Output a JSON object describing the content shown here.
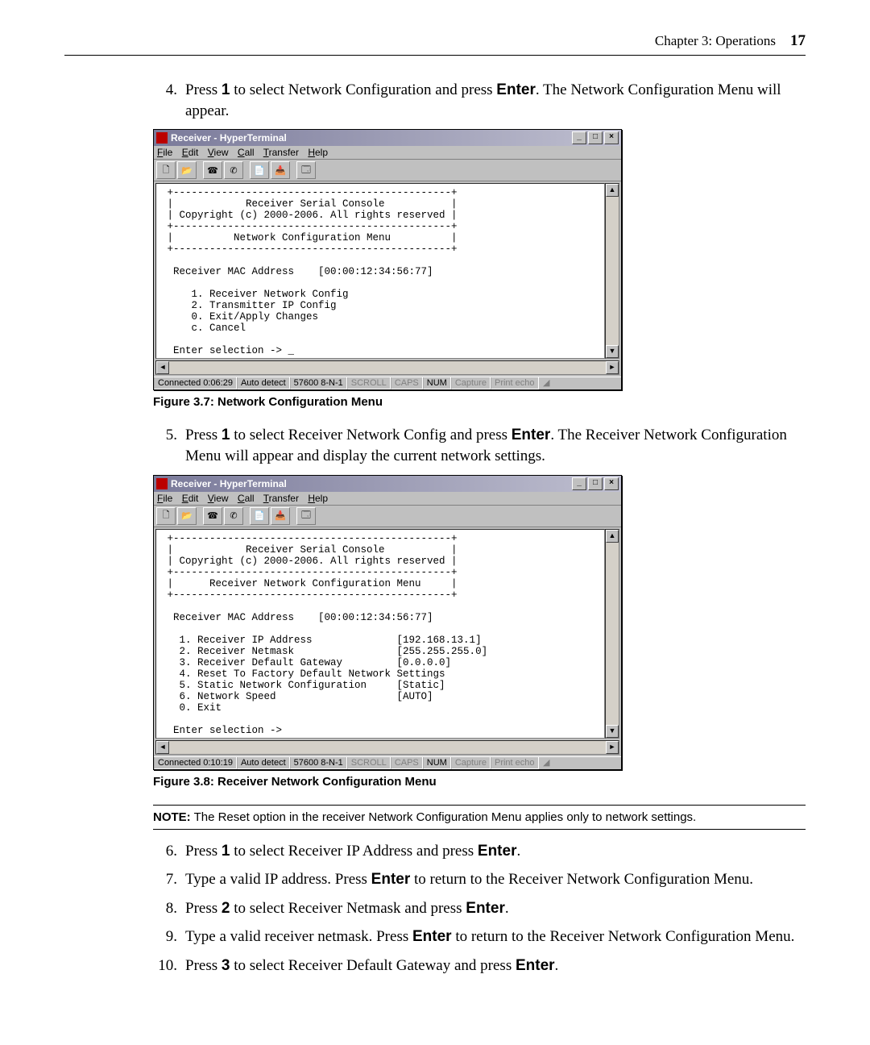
{
  "header": {
    "chapter": "Chapter 3: Operations",
    "page": "17"
  },
  "steps": {
    "s4": {
      "num": "4.",
      "pre": "Press ",
      "b1": "1",
      "mid1": " to select Network Configuration and press ",
      "b2": "Enter",
      "post": ". The Network Configuration Menu will appear."
    },
    "s5": {
      "num": "5.",
      "pre": "Press ",
      "b1": "1",
      "mid1": " to select Receiver Network Config and press ",
      "b2": "Enter",
      "post": ". The Receiver Network Configuration Menu will appear and display the current network settings."
    },
    "s6": {
      "num": "6.",
      "pre": "Press ",
      "b1": "1",
      "mid1": " to select Receiver IP Address and press ",
      "b2": "Enter",
      "post": "."
    },
    "s7": {
      "num": "7.",
      "pre": "Type a valid IP address. Press ",
      "b1": "Enter",
      "post": " to return to the Receiver Network Configuration Menu."
    },
    "s8": {
      "num": "8.",
      "pre": "Press ",
      "b1": "2",
      "mid1": " to select Receiver Netmask and press ",
      "b2": "Enter",
      "post": "."
    },
    "s9": {
      "num": "9.",
      "pre": "Type a valid receiver netmask. Press ",
      "b1": "Enter",
      "post": " to return to the Receiver Network Configuration Menu."
    },
    "s10": {
      "num": "10.",
      "pre": "Press ",
      "b1": "3",
      "mid1": " to select Receiver Default Gateway and press ",
      "b2": "Enter",
      "post": "."
    }
  },
  "captions": {
    "f37": "Figure 3.7: Network Configuration Menu",
    "f38": "Figure 3.8: Receiver Network Configuration Menu"
  },
  "note": {
    "label": "NOTE:",
    "text": " The Reset option in the receiver Network Configuration Menu applies only to network settings."
  },
  "hyperterm": {
    "title": "Receiver - HyperTerminal",
    "menus": {
      "file": "File",
      "edit": "Edit",
      "view": "View",
      "call": "Call",
      "transfer": "Transfer",
      "help": "Help"
    },
    "term1": " +----------------------------------------------+\n |            Receiver Serial Console           |\n | Copyright (c) 2000-2006. All rights reserved |\n +----------------------------------------------+\n |          Network Configuration Menu          |\n +----------------------------------------------+\n\n  Receiver MAC Address    [00:00:12:34:56:77]\n\n     1. Receiver Network Config\n     2. Transmitter IP Config\n     0. Exit/Apply Changes\n     c. Cancel\n\n  Enter selection -> _\n",
    "term2": " +----------------------------------------------+\n |            Receiver Serial Console           |\n | Copyright (c) 2000-2006. All rights reserved |\n +----------------------------------------------+\n |      Receiver Network Configuration Menu     |\n +----------------------------------------------+\n\n  Receiver MAC Address    [00:00:12:34:56:77]\n\n   1. Receiver IP Address              [192.168.13.1]\n   2. Receiver Netmask                 [255.255.255.0]\n   3. Receiver Default Gateway         [0.0.0.0]\n   4. Reset To Factory Default Network Settings\n   5. Static Network Configuration     [Static]\n   6. Network Speed                    [AUTO]\n   0. Exit\n\n  Enter selection ->\n",
    "status1": {
      "conn": "Connected 0:06:29",
      "detect": "Auto detect",
      "baud": "57600 8-N-1",
      "scroll": "SCROLL",
      "caps": "CAPS",
      "num": "NUM",
      "capture": "Capture",
      "echo": "Print echo"
    },
    "status2": {
      "conn": "Connected 0:10:19",
      "detect": "Auto detect",
      "baud": "57600 8-N-1",
      "scroll": "SCROLL",
      "caps": "CAPS",
      "num": "NUM",
      "capture": "Capture",
      "echo": "Print echo"
    },
    "ctrl": {
      "min": "_",
      "max": "□",
      "close": "×"
    }
  }
}
